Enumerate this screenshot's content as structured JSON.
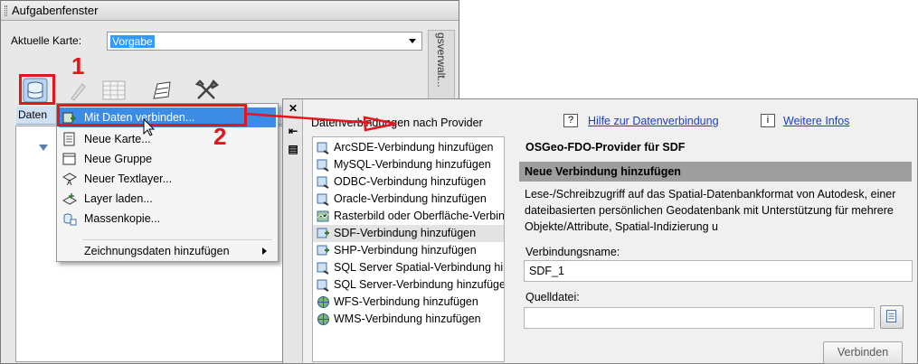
{
  "taskpane": {
    "title": "Aufgabenfenster",
    "map_label": "Aktuelle Karte:",
    "map_value": "Vorgabe",
    "side_tab": "gsverwalt...",
    "tab_label": "Daten"
  },
  "context_menu": {
    "items": [
      {
        "label": "Mit Daten verbinden...",
        "icon": "data-connect-icon"
      },
      {
        "label": "Neue Karte...",
        "icon": "new-map-icon"
      },
      {
        "label": "Neue Gruppe",
        "icon": "new-group-icon"
      },
      {
        "label": "Neuer Textlayer...",
        "icon": "text-layer-icon"
      },
      {
        "label": "Layer laden...",
        "icon": "load-layer-icon"
      },
      {
        "label": "Massenkopie...",
        "icon": "bulk-copy-icon"
      },
      {
        "label": "Zeichnungsdaten hinzufügen",
        "icon": "submenu-arrow-icon"
      }
    ]
  },
  "data_connect": {
    "providers_heading": "Datenverbindungen nach Provider",
    "providers": [
      "ArcSDE-Verbindung hinzufügen",
      "MySQL-Verbindung hinzufügen",
      "ODBC-Verbindung hinzufügen",
      "Oracle-Verbindung hinzufügen",
      "Rasterbild oder Oberfläche-Verbindung hinzufügen",
      "SDF-Verbindung hinzufügen",
      "SHP-Verbindung hinzufügen",
      "SQL Server Spatial-Verbindung hinzufügen",
      "SQL Server-Verbindung hinzufügen",
      "WFS-Verbindung hinzufügen",
      "WMS-Verbindung hinzufügen"
    ],
    "selected_provider_index": 5,
    "help_box": "?",
    "help_link": "Hilfe zur Datenverbindung",
    "info_box": "i",
    "info_link": "Weitere Infos",
    "provider_title": "OSGeo-FDO-Provider für SDF",
    "section_title": "Neue Verbindung hinzufügen",
    "description": "Lese-/Schreibzugriff auf das Spatial-Datenbankformat von Autodesk, einer dateibasierten persönlichen Geodatenbank mit Unterstützung für mehrere Objekte/Attribute, Spatial-Indizierung u",
    "connection_name_label": "Verbindungsname:",
    "connection_name_value": "SDF_1",
    "source_file_label": "Quelldatei:",
    "source_file_value": "",
    "connect_button": "Verbinden"
  },
  "annotations": {
    "step1": "1",
    "step2": "2",
    "color": "#e4161b"
  }
}
